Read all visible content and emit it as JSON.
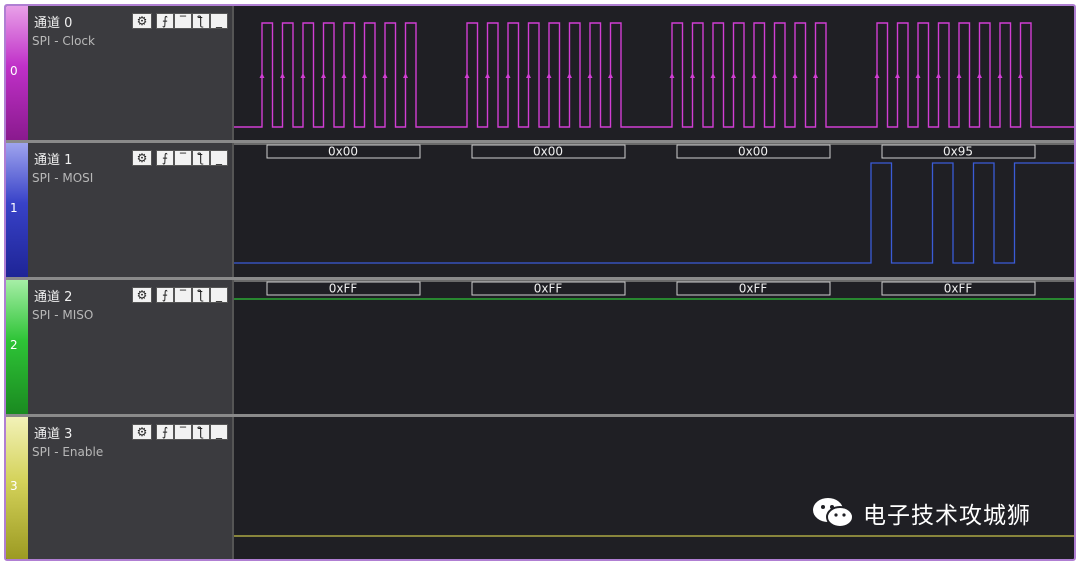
{
  "channels": [
    {
      "title": "通道 0",
      "subtitle": "SPI - Clock",
      "number": "0",
      "color": "#d13ed4"
    },
    {
      "title": "通道 1",
      "subtitle": "SPI - MOSI",
      "number": "1",
      "color": "#3b47c9"
    },
    {
      "title": "通道 2",
      "subtitle": "SPI - MISO",
      "number": "2",
      "color": "#2ec437"
    },
    {
      "title": "通道 3",
      "subtitle": "SPI - Enable",
      "number": "3",
      "color": "#d9d86a"
    }
  ],
  "buttons": {
    "gear": "⚙",
    "rising": "⨍",
    "high": "‾",
    "falling": "ƪ",
    "low": "_"
  },
  "decodes": {
    "mosi": [
      "0x00",
      "0x00",
      "0x00",
      "0x95"
    ],
    "miso": [
      "0xFF",
      "0xFF",
      "0xFF",
      "0xFF"
    ]
  },
  "signals": {
    "clock_bits_per_byte": 8,
    "mosi_bits": [
      [
        0,
        0,
        0,
        0,
        0,
        0,
        0,
        0
      ],
      [
        0,
        0,
        0,
        0,
        0,
        0,
        0,
        0
      ],
      [
        0,
        0,
        0,
        0,
        0,
        0,
        0,
        0
      ],
      [
        1,
        0,
        0,
        1,
        0,
        1,
        0,
        1
      ]
    ],
    "miso_level": 1,
    "enable_level": 0
  },
  "watermark": {
    "text": "电子技术攻城狮",
    "icon": "wechat-icon"
  }
}
